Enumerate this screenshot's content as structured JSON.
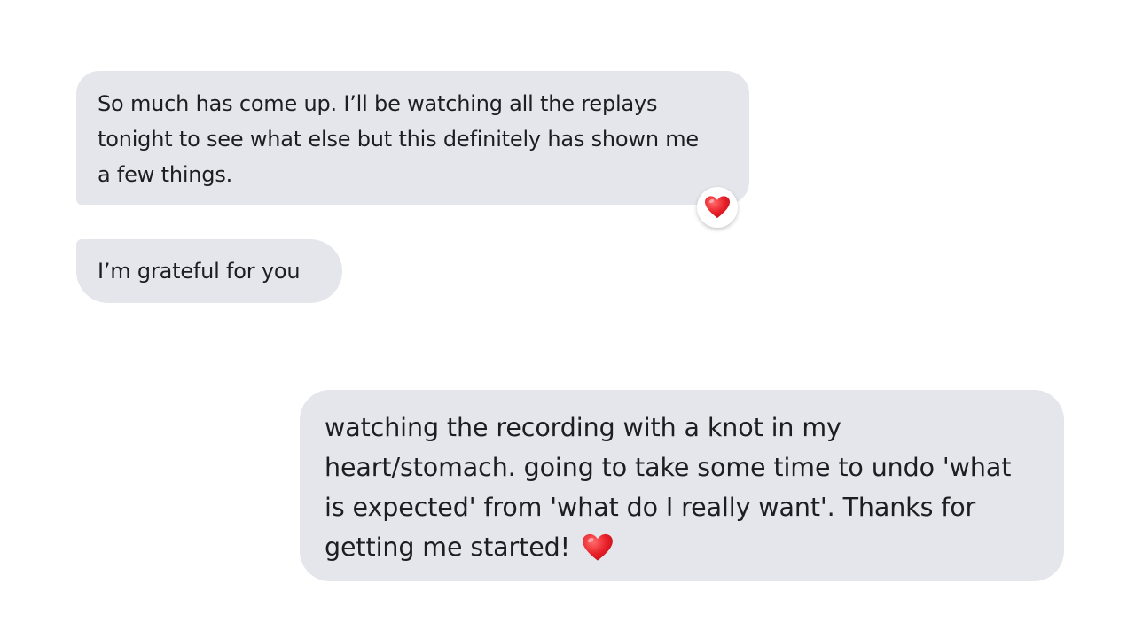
{
  "messages": [
    {
      "text": "So much has come up. I’ll be watching all the replays tonight to see what else but this definitely has shown me a few things.",
      "reaction_icon": "heart-icon"
    },
    {
      "text": "I’m grateful for you"
    },
    {
      "text": "watching the recording with a knot in my heart/stomach. going to take some time to undo 'what is expected' from 'what do I really want'. Thanks for getting me started!",
      "trailing_icon": "heart-icon"
    }
  ],
  "colors": {
    "bubble_background": "#e4e6eb",
    "text": "#1c1e21",
    "heart": "#e8202a"
  }
}
